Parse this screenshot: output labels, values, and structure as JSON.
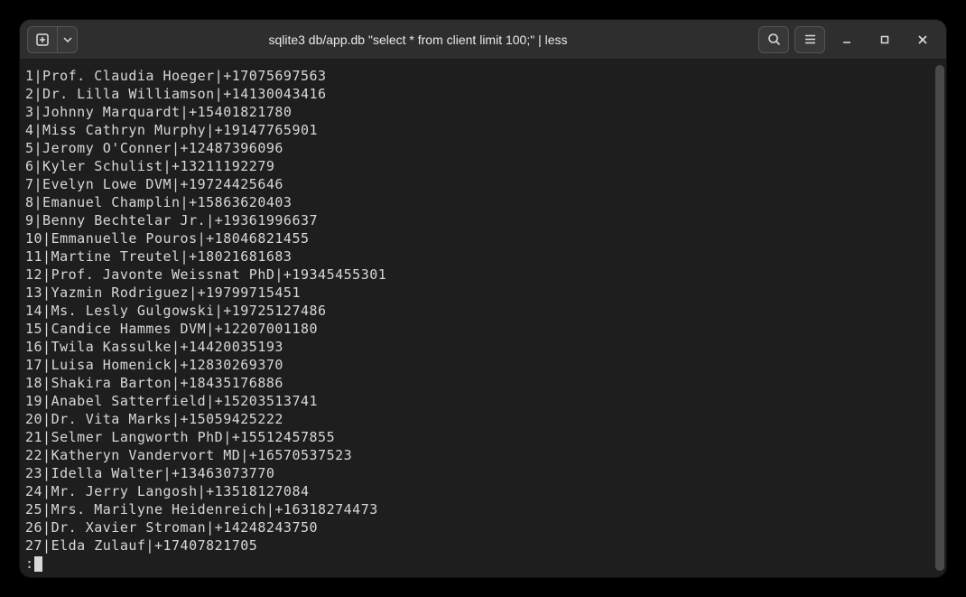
{
  "titlebar": {
    "title": "sqlite3 db/app.db \"select * from client limit 100;\" | less"
  },
  "rows": [
    {
      "id": 1,
      "name": "Prof. Claudia Hoeger",
      "phone": "+17075697563"
    },
    {
      "id": 2,
      "name": "Dr. Lilla Williamson",
      "phone": "+14130043416"
    },
    {
      "id": 3,
      "name": "Johnny Marquardt",
      "phone": "+15401821780"
    },
    {
      "id": 4,
      "name": "Miss Cathryn Murphy",
      "phone": "+19147765901"
    },
    {
      "id": 5,
      "name": "Jeromy O'Conner",
      "phone": "+12487396096"
    },
    {
      "id": 6,
      "name": "Kyler Schulist",
      "phone": "+13211192279"
    },
    {
      "id": 7,
      "name": "Evelyn Lowe DVM",
      "phone": "+19724425646"
    },
    {
      "id": 8,
      "name": "Emanuel Champlin",
      "phone": "+15863620403"
    },
    {
      "id": 9,
      "name": "Benny Bechtelar Jr.",
      "phone": "+19361996637"
    },
    {
      "id": 10,
      "name": "Emmanuelle Pouros",
      "phone": "+18046821455"
    },
    {
      "id": 11,
      "name": "Martine Treutel",
      "phone": "+18021681683"
    },
    {
      "id": 12,
      "name": "Prof. Javonte Weissnat PhD",
      "phone": "+19345455301"
    },
    {
      "id": 13,
      "name": "Yazmin Rodriguez",
      "phone": "+19799715451"
    },
    {
      "id": 14,
      "name": "Ms. Lesly Gulgowski",
      "phone": "+19725127486"
    },
    {
      "id": 15,
      "name": "Candice Hammes DVM",
      "phone": "+12207001180"
    },
    {
      "id": 16,
      "name": "Twila Kassulke",
      "phone": "+14420035193"
    },
    {
      "id": 17,
      "name": "Luisa Homenick",
      "phone": "+12830269370"
    },
    {
      "id": 18,
      "name": "Shakira Barton",
      "phone": "+18435176886"
    },
    {
      "id": 19,
      "name": "Anabel Satterfield",
      "phone": "+15203513741"
    },
    {
      "id": 20,
      "name": "Dr. Vita Marks",
      "phone": "+15059425222"
    },
    {
      "id": 21,
      "name": "Selmer Langworth PhD",
      "phone": "+15512457855"
    },
    {
      "id": 22,
      "name": "Katheryn Vandervort MD",
      "phone": "+16570537523"
    },
    {
      "id": 23,
      "name": "Idella Walter",
      "phone": "+13463073770"
    },
    {
      "id": 24,
      "name": "Mr. Jerry Langosh",
      "phone": "+13518127084"
    },
    {
      "id": 25,
      "name": "Mrs. Marilyne Heidenreich",
      "phone": "+16318274473"
    },
    {
      "id": 26,
      "name": "Dr. Xavier Stroman",
      "phone": "+14248243750"
    },
    {
      "id": 27,
      "name": "Elda Zulauf",
      "phone": "+17407821705"
    }
  ],
  "less_prompt": ":"
}
